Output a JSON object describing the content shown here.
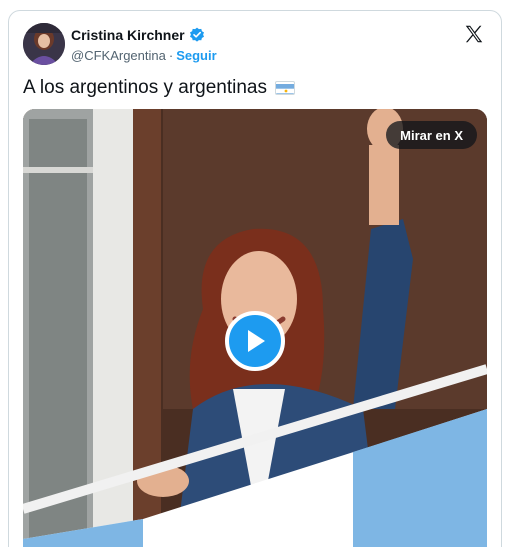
{
  "author": {
    "name": "Cristina Kirchner",
    "handle": "@CFKArgentina",
    "separator": "·",
    "follow_label": "Seguir"
  },
  "tweet": {
    "text": "A los argentinos y argentinas",
    "emoji": "argentina-flag-emoji"
  },
  "media": {
    "watch_label": "Mirar en X",
    "play_icon": "play-icon"
  },
  "icons": {
    "verified": "verified-badge-icon",
    "brand": "x-logo-icon"
  },
  "colors": {
    "accent": "#1d9bf0",
    "text": "#0f1419",
    "muted": "#536471",
    "border": "#cfd9de"
  }
}
